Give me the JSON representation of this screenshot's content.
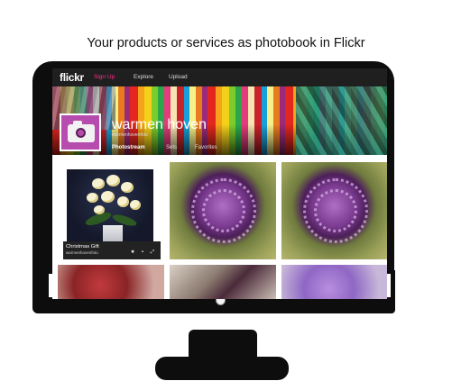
{
  "caption": "Your products or services as photobook in Flickr",
  "flickr": {
    "logo": "flickr",
    "nav": {
      "you": "Sign Up",
      "explore": "Explore",
      "upload": "Upload"
    },
    "profile": {
      "username": "warmen hoven",
      "subline": "warmenhovenfoto",
      "avatar_icon": "camera-icon"
    },
    "tabs": [
      "Photostream",
      "Sets",
      "Favorites"
    ],
    "photos": [
      {
        "title": "Christmas Gift",
        "by": "warmenhovenfoto",
        "subject": "white orchids in pot"
      },
      {
        "subject": "purple allium"
      },
      {
        "subject": "purple allium"
      },
      {
        "subject": "red flowers"
      },
      {
        "subject": "dark purple blooms"
      },
      {
        "subject": "lilac allium"
      }
    ],
    "colors": {
      "nav_bg": "#1f1f1f",
      "you_accent": "#ff2d8a",
      "avatar_bg": "#b54cae"
    }
  }
}
